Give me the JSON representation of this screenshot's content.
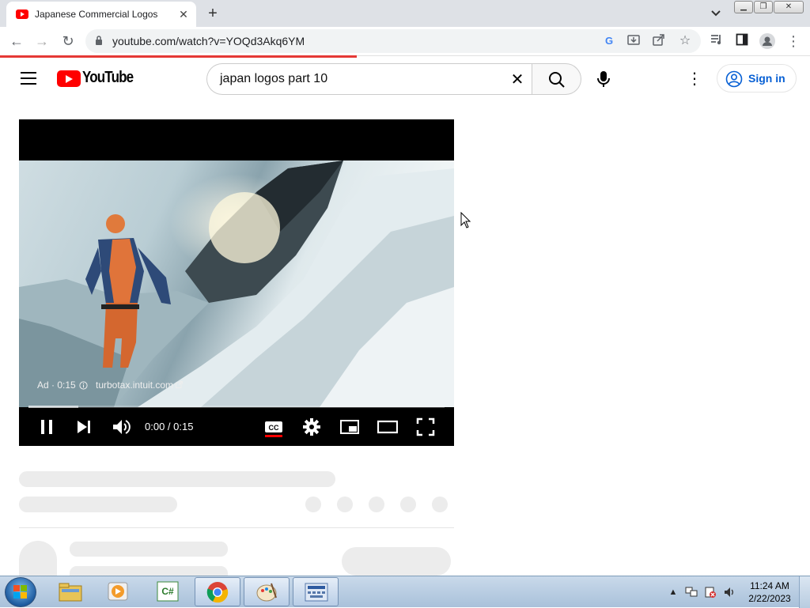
{
  "browser": {
    "tab": {
      "title": "Japanese Commercial Logos",
      "close_glyph": "✕"
    },
    "new_tab_glyph": "+",
    "tab_search_glyph": "⌄",
    "window_buttons": {
      "minimize": "▁",
      "restore": "❐",
      "close": "✕"
    },
    "nav": {
      "back": "←",
      "forward": "→",
      "reload": "↻"
    },
    "address": {
      "url": "youtube.com/watch?v=YOQd3Akq6YM"
    },
    "omnibox_icons": [
      "google-icon",
      "install-icon",
      "share-icon",
      "bookmark-star-icon"
    ],
    "toolbar_icons": [
      "media-control-icon",
      "side-panel-icon",
      "profile-icon",
      "menu-kebab-icon"
    ],
    "page_load_progress": 0.44
  },
  "youtube": {
    "wordmark": "YouTube",
    "search": {
      "query": "japan logos part 10",
      "clear_glyph": "✕"
    },
    "kebab_glyph": "⋮",
    "sign_in": "Sign in"
  },
  "player": {
    "ad_label": "Ad · 0:15",
    "ad_site": "turbotax.intuit.com",
    "ad_site_icon": "external-link-icon",
    "time": "0:00 / 0:15",
    "watched_fraction": 0.0,
    "buffered_fraction": 0.12,
    "captions_label": "CC",
    "controls": [
      "pause-icon",
      "next-icon",
      "volume-icon",
      "captions-icon",
      "settings-icon",
      "miniplayer-icon",
      "theater-icon",
      "fullscreen-icon"
    ]
  },
  "taskbar": {
    "apps": [
      "windows-explorer-icon",
      "media-player-icon",
      "csharp-editor-icon",
      "chrome-icon",
      "paint-icon",
      "on-screen-keyboard-icon"
    ],
    "clock_time": "11:24 AM",
    "clock_date": "2/22/2023",
    "tray_icons": [
      "show-hidden-icons",
      "network-icon",
      "action-center-icon",
      "volume-icon"
    ]
  }
}
